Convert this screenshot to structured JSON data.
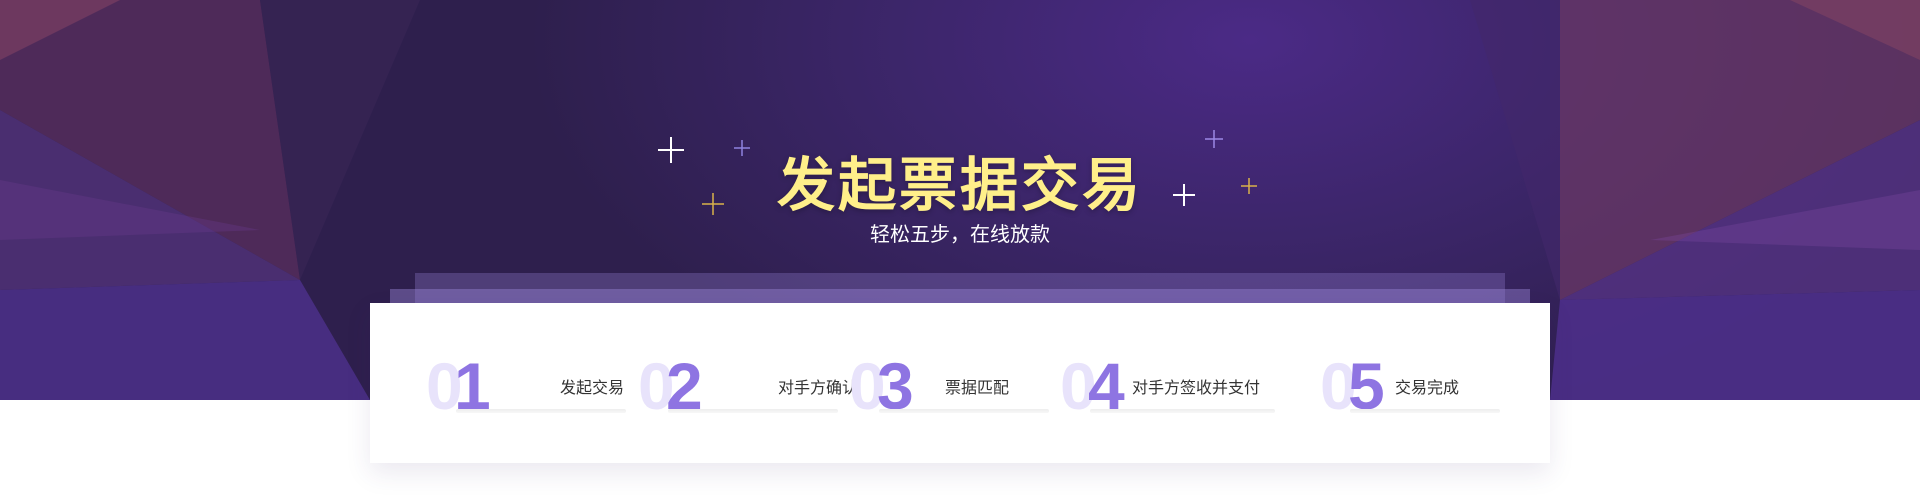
{
  "banner": {
    "title": "发起票据交易",
    "subtitle": "轻松五步，在线放款"
  },
  "steps": [
    {
      "ghost": "0",
      "number": "1",
      "label": "发起交易"
    },
    {
      "ghost": "0",
      "number": "2",
      "label": "对手方确认"
    },
    {
      "ghost": "0",
      "number": "3",
      "label": "票据匹配"
    },
    {
      "ghost": "0",
      "number": "4",
      "label": "对手方签收并支付"
    },
    {
      "ghost": "0",
      "number": "5",
      "label": "交易完成"
    }
  ],
  "colors": {
    "title": "#ffef8a",
    "step_number": "#8e74e2",
    "step_ghost": "#e8e3fb",
    "hero_dark": "#2e1f4d",
    "hero_purple": "#4b2a86",
    "hero_magenta": "#6b3a6a"
  }
}
